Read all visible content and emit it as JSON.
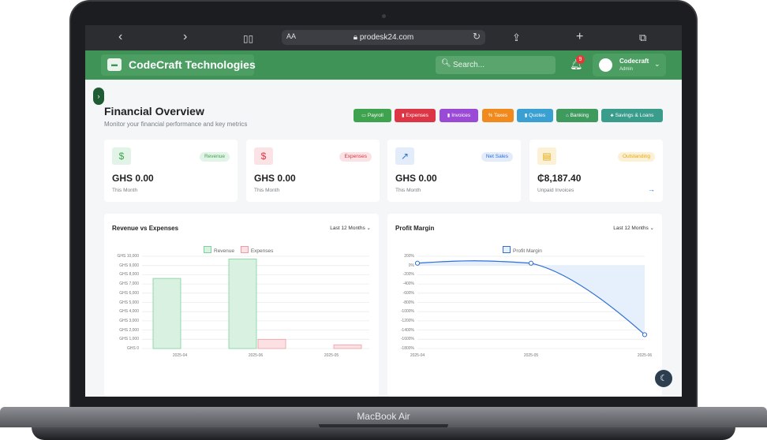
{
  "device": {
    "label": "MacBook Air"
  },
  "browser": {
    "url": "prodesk24.com",
    "text_size_label": "AA",
    "icons": [
      "back-icon",
      "forward-icon",
      "book-icon",
      "share-icon",
      "plus-icon",
      "tabs-icon",
      "reload-icon",
      "lock-icon"
    ]
  },
  "app": {
    "brand": "CodeCraft Technologies",
    "search_placeholder": "Search...",
    "notifications_count": "9",
    "user": {
      "name": "Codecraft",
      "role": "Admin"
    }
  },
  "page": {
    "title": "Financial Overview",
    "subtitle": "Monitor your financial performance and key metrics"
  },
  "quick_links": [
    {
      "label": "Payroll",
      "color": "#3fa24f"
    },
    {
      "label": "Expenses",
      "color": "#dc3545"
    },
    {
      "label": "Invoices",
      "color": "#9b4ad6"
    },
    {
      "label": "Taxes",
      "color": "#f08a1c"
    },
    {
      "label": "Quotes",
      "color": "#3aa0d2"
    },
    {
      "label": "Banking",
      "color": "#3f9a5e"
    },
    {
      "label": "Savings & Loans",
      "color": "#3a9d8c"
    }
  ],
  "stats": [
    {
      "badge": "Revenue",
      "value": "GHS 0.00",
      "label": "This Month",
      "icon": "$",
      "accent": "#3fa24f"
    },
    {
      "badge": "Expenses",
      "value": "GHS 0.00",
      "label": "This Month",
      "icon": "$",
      "accent": "#dc3545"
    },
    {
      "badge": "Net Sales",
      "value": "GHS 0.00",
      "label": "This Month",
      "icon": "↗",
      "accent": "#2f6fd6"
    },
    {
      "badge": "Outstanding",
      "value": "₵8,187.40",
      "label": "Unpaid Invoices",
      "icon": "▤",
      "accent": "#e6a817"
    }
  ],
  "chart_data": [
    {
      "type": "bar",
      "title": "Revenue vs Expenses",
      "period": "Last 12 Months",
      "categories": [
        "2025-04",
        "2025-06",
        "2025-05"
      ],
      "series": [
        {
          "name": "Revenue",
          "values": [
            7600,
            9700,
            0
          ],
          "color": "#9fd9b4"
        },
        {
          "name": "Expenses",
          "values": [
            0,
            1000,
            400
          ],
          "color": "#f4b4b9"
        }
      ],
      "yticks": [
        "GHS 10,000",
        "GHS 9,000",
        "GHS 8,000",
        "GHS 7,000",
        "GHS 6,000",
        "GHS 5,000",
        "GHS 4,000",
        "GHS 3,000",
        "GHS 2,000",
        "GHS 1,000",
        "GHS 0"
      ],
      "ylim": [
        0,
        10000
      ]
    },
    {
      "type": "area",
      "title": "Profit Margin",
      "period": "Last 12 Months",
      "categories": [
        "2025-04",
        "2025-05",
        "2025-06"
      ],
      "series": [
        {
          "name": "Profit Margin",
          "values": [
            50,
            50,
            -1500
          ],
          "color": "#2f6fd6"
        }
      ],
      "yticks": [
        "200%",
        "0%",
        "-200%",
        "-400%",
        "-600%",
        "-800%",
        "-1000%",
        "-1200%",
        "-1400%",
        "-1600%",
        "-1800%"
      ],
      "ylim": [
        -1800,
        200
      ]
    }
  ]
}
